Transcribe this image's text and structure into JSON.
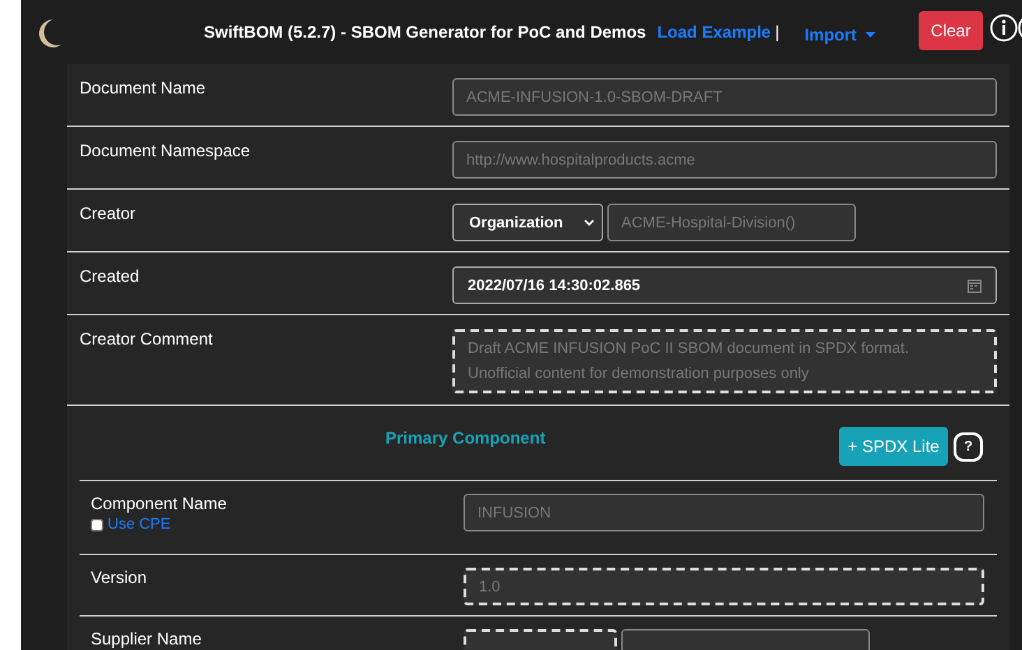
{
  "header": {
    "title": "SwiftBOM (5.2.7) - SBOM Generator for PoC and Demos",
    "load_example": "Load Example",
    "separator": "|",
    "import_menu": "Import",
    "clear_button": "Clear"
  },
  "document_fields": [
    {
      "label": "Document Name",
      "kind": "input",
      "placeholder": "ACME-INFUSION-1.0-SBOM-DRAFT",
      "dashed": false
    },
    {
      "label": "Document Namespace",
      "kind": "input",
      "placeholder": "http://www.hospitalproducts.acme",
      "dashed": false
    },
    {
      "label": "Creator",
      "kind": "select-input",
      "select": "Organization",
      "placeholder": "ACME-Hospital-Division()",
      "dashed": false
    },
    {
      "label": "Created",
      "kind": "date",
      "value": "2022/07/16 14:30:02.865",
      "dashed": false
    },
    {
      "label": "Creator Comment",
      "kind": "textarea",
      "placeholder": "Draft ACME INFUSION PoC II SBOM document in SPDX format. Unofficial content for demonstration purposes only",
      "dashed": true
    }
  ],
  "primary_component": {
    "title": "Primary Component",
    "spdx_button": "+ SPDX Lite",
    "help_button": "?",
    "fields": [
      {
        "label": "Component Name",
        "kind": "input",
        "placeholder": "INFUSION",
        "dashed": false,
        "cpe": {
          "label": "Use CPE",
          "checked": false
        }
      },
      {
        "label": "Version",
        "kind": "input",
        "placeholder": "1.0",
        "dashed": true
      },
      {
        "label": "Supplier Name",
        "kind": "pair",
        "dashed": true
      }
    ]
  }
}
